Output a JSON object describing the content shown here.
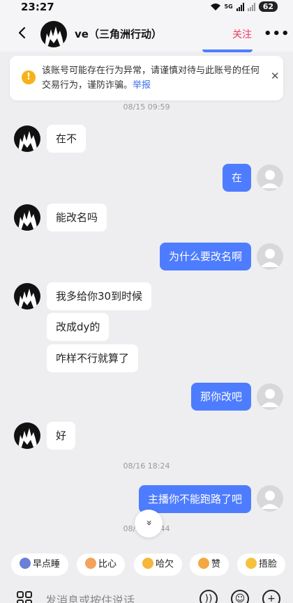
{
  "status_bar": {
    "time": "23:27",
    "network": "5G",
    "battery": "62"
  },
  "header": {
    "name": "ve（三角洲行动）",
    "follow_label": "关注",
    "more_label": "•••"
  },
  "warning": {
    "text": "该账号可能存在行为异常，请谨慎对待与此账号的任何交易行为，谨防诈骗。",
    "link": "举报",
    "icon": "!",
    "close": "✕"
  },
  "messages": {
    "ts1": "08/15 09:59",
    "m1": "在不",
    "m2": "在",
    "m3": "能改名吗",
    "m4": "为什么要改名啊",
    "m5": "我多给你30到时候",
    "m6": "改成dy的",
    "m7": "咋样不行就算了",
    "m8": "那你改吧",
    "m9": "好",
    "ts2": "08/16 18:24",
    "m10": "主播你不能跑路了吧",
    "ts3": "08/16 18:44"
  },
  "scroll_down_label": "»",
  "quick_replies": [
    "早点睡",
    "比心",
    "哈欠",
    "赞",
    "捂脸"
  ],
  "input": {
    "placeholder": "发消息或按住说话..."
  },
  "colors": {
    "accent": "#4d7cfe",
    "follow": "#f2385a",
    "warning_icon": "#f6b21a",
    "link": "#3a6ee8"
  }
}
